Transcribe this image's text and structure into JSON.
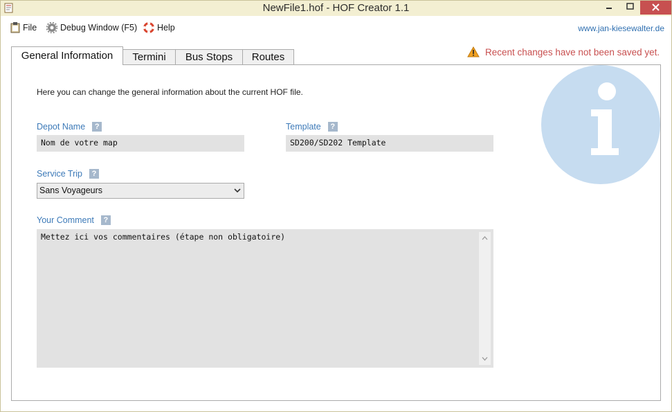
{
  "window": {
    "title": "NewFile1.hof - HOF Creator 1.1"
  },
  "menu": {
    "file": "File",
    "debug": "Debug Window (F5)",
    "help": "Help",
    "weblink": "www.jan-kiesewalter.de"
  },
  "status": {
    "warning": "Recent changes have not been saved yet."
  },
  "tabs": [
    "General Information",
    "Termini",
    "Bus Stops",
    "Routes"
  ],
  "general": {
    "intro": "Here you can change the general information about the current HOF file.",
    "depot_label": "Depot Name",
    "depot_value": "Nom de votre map",
    "template_label": "Template",
    "template_value": "SD200/SD202 Template",
    "service_label": "Service Trip",
    "service_value": "Sans Voyageurs",
    "comment_label": "Your Comment",
    "comment_value": "Mettez ici vos commentaires (étape non obligatoire)",
    "help_glyph": "?"
  },
  "colors": {
    "label_blue": "#3d7ab8",
    "warning_red": "#c85050",
    "info_circle": "#c6dcf0",
    "titlebar": "#f3efd2",
    "close_red": "#c75050"
  }
}
